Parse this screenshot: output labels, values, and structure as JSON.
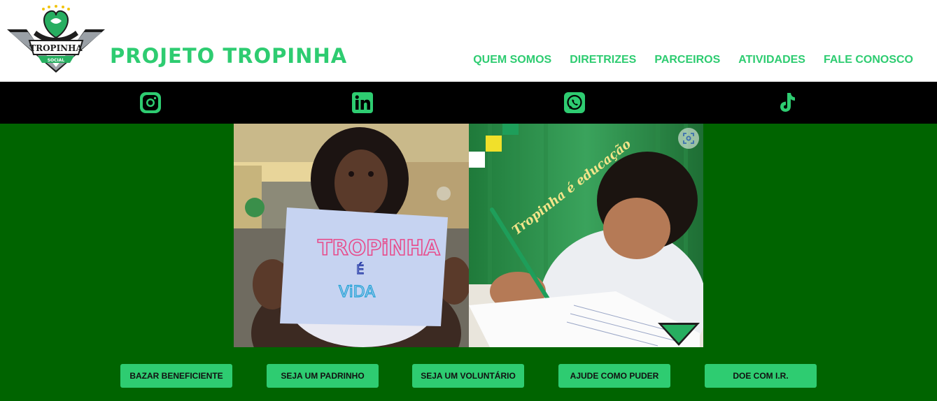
{
  "header": {
    "site_title": "PROJETO TROPINHA",
    "logo": {
      "name": "TROPINHA",
      "subtitle": "SOCIAL"
    }
  },
  "nav": {
    "items": [
      {
        "label": "QUEM SOMOS"
      },
      {
        "label": "DIRETRIZES"
      },
      {
        "label": "PARCEIROS"
      },
      {
        "label": "ATIVIDADES"
      },
      {
        "label": "FALE CONOSCO"
      }
    ]
  },
  "social": {
    "icons": [
      "instagram-icon",
      "linkedin-icon",
      "whatsapp-icon",
      "tiktok-icon"
    ]
  },
  "hero": {
    "left_sign": {
      "line1": "TROPiNHA",
      "line2": "É",
      "line3": "ViDA"
    },
    "right_caption": "Tropinha é educação"
  },
  "cta": {
    "buttons": [
      {
        "label": "BAZAR BENEFICIENTE"
      },
      {
        "label": "SEJA UM PADRINHO"
      },
      {
        "label": "SEJA UM VOLUNTÁRIO"
      },
      {
        "label": "AJUDE COMO PUDER"
      },
      {
        "label": "DOE COM I.R."
      }
    ]
  },
  "colors": {
    "brand_green": "#2ecc71",
    "background_green": "#006400",
    "social_bar": "#000000",
    "header_bg": "#ffffff"
  }
}
